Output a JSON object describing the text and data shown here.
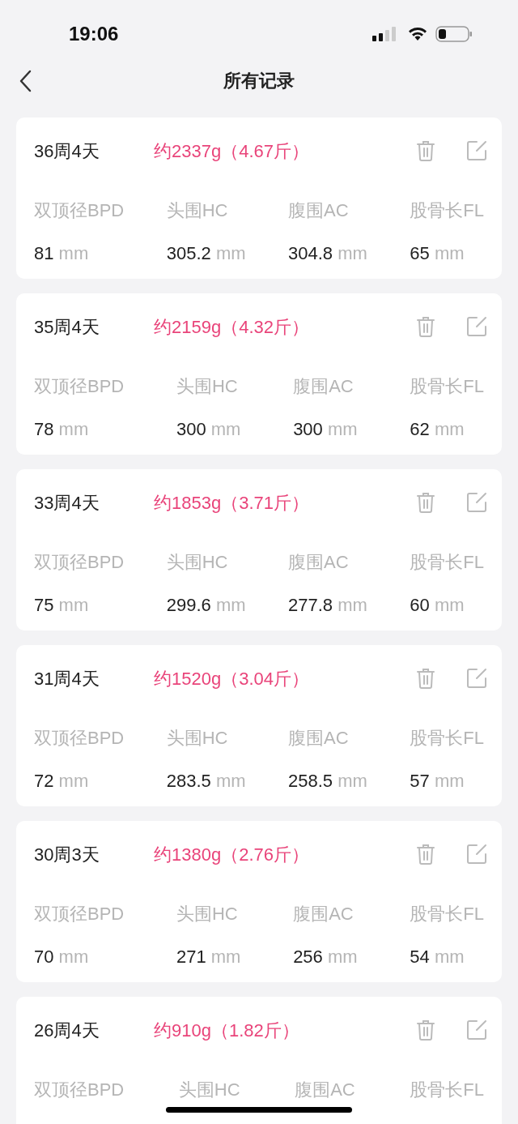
{
  "status_bar": {
    "time": "19:06"
  },
  "header": {
    "title": "所有记录"
  },
  "records": [
    {
      "gestation": "36周4天",
      "weight": "约2337g（4.67斤）",
      "measures": [
        {
          "label": "双顶径BPD",
          "value": "81",
          "unit": "mm"
        },
        {
          "label": "头围HC",
          "value": "305.2",
          "unit": "mm"
        },
        {
          "label": "腹围AC",
          "value": "304.8",
          "unit": "mm"
        },
        {
          "label": "股骨长FL",
          "value": "65",
          "unit": "mm"
        }
      ]
    },
    {
      "gestation": "35周4天",
      "weight": "约2159g（4.32斤）",
      "measures": [
        {
          "label": "双顶径BPD",
          "value": "78",
          "unit": "mm"
        },
        {
          "label": "头围HC",
          "value": "300",
          "unit": "mm"
        },
        {
          "label": "腹围AC",
          "value": "300",
          "unit": "mm"
        },
        {
          "label": "股骨长FL",
          "value": "62",
          "unit": "mm"
        }
      ]
    },
    {
      "gestation": "33周4天",
      "weight": "约1853g（3.71斤）",
      "measures": [
        {
          "label": "双顶径BPD",
          "value": "75",
          "unit": "mm"
        },
        {
          "label": "头围HC",
          "value": "299.6",
          "unit": "mm"
        },
        {
          "label": "腹围AC",
          "value": "277.8",
          "unit": "mm"
        },
        {
          "label": "股骨长FL",
          "value": "60",
          "unit": "mm"
        }
      ]
    },
    {
      "gestation": "31周4天",
      "weight": "约1520g（3.04斤）",
      "measures": [
        {
          "label": "双顶径BPD",
          "value": "72",
          "unit": "mm"
        },
        {
          "label": "头围HC",
          "value": "283.5",
          "unit": "mm"
        },
        {
          "label": "腹围AC",
          "value": "258.5",
          "unit": "mm"
        },
        {
          "label": "股骨长FL",
          "value": "57",
          "unit": "mm"
        }
      ]
    },
    {
      "gestation": "30周3天",
      "weight": "约1380g（2.76斤）",
      "measures": [
        {
          "label": "双顶径BPD",
          "value": "70",
          "unit": "mm"
        },
        {
          "label": "头围HC",
          "value": "271",
          "unit": "mm"
        },
        {
          "label": "腹围AC",
          "value": "256",
          "unit": "mm"
        },
        {
          "label": "股骨长FL",
          "value": "54",
          "unit": "mm"
        }
      ]
    },
    {
      "gestation": "26周4天",
      "weight": "约910g（1.82斤）",
      "measures": [
        {
          "label": "双顶径BPD"
        },
        {
          "label": "头围HC"
        },
        {
          "label": "腹围AC"
        },
        {
          "label": "股骨长FL"
        }
      ]
    }
  ]
}
